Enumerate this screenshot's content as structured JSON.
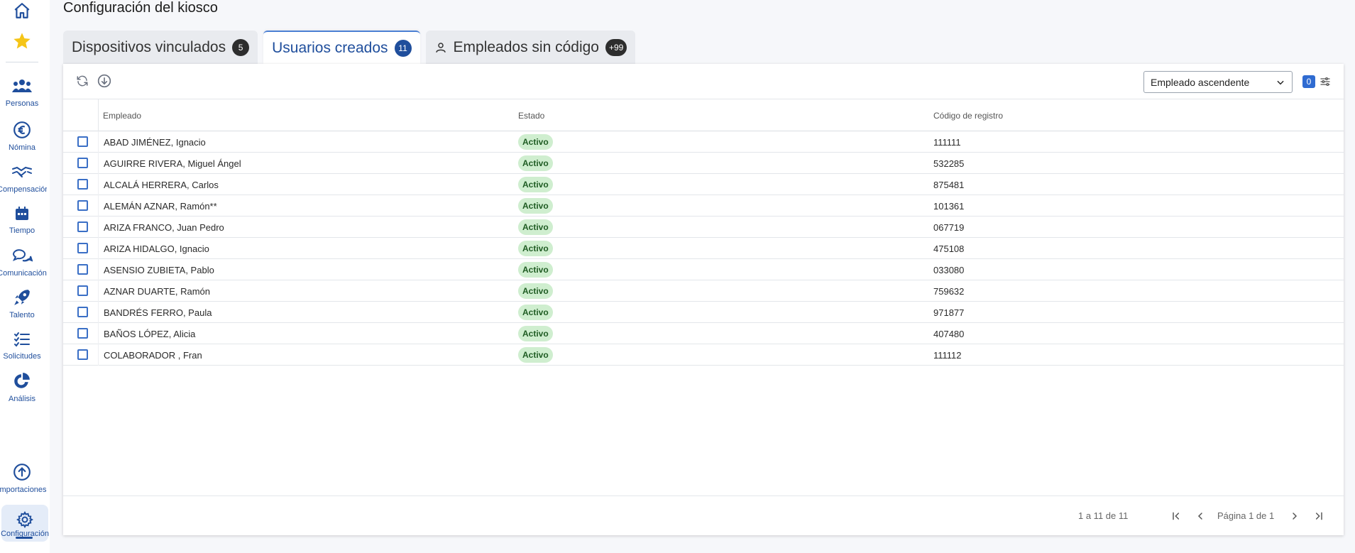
{
  "sidebar": {
    "items": [
      {
        "label": "Personas",
        "icon": "people-icon"
      },
      {
        "label": "Nómina",
        "icon": "euro-icon"
      },
      {
        "label": "Compensación",
        "icon": "handshake-icon"
      },
      {
        "label": "Tiempo",
        "icon": "calendar-icon"
      },
      {
        "label": "Comunicación",
        "icon": "chat-icon"
      },
      {
        "label": "Talento",
        "icon": "rocket-icon"
      },
      {
        "label": "Solicitudes",
        "icon": "checklist-icon"
      },
      {
        "label": "Análisis",
        "icon": "pie-chart-icon"
      },
      {
        "label": "Importaciones",
        "icon": "upload-icon"
      },
      {
        "label": "Configuración",
        "icon": "gear-icon"
      }
    ],
    "accent": "#1f4e9c"
  },
  "header": {
    "title": "Configuración del kiosco"
  },
  "tabs": [
    {
      "label": "Dispositivos vinculados",
      "count": "5"
    },
    {
      "label": "Usuarios creados",
      "count": "11"
    },
    {
      "label": "Empleados sin código",
      "count": "+99"
    }
  ],
  "toolbar": {
    "sort_value": "Empleado ascendente",
    "filter_count": "0"
  },
  "table": {
    "columns": [
      "Empleado",
      "Estado",
      "Código de registro"
    ],
    "rows": [
      {
        "name": "ABAD JIMÉNEZ, Ignacio",
        "status": "Activo",
        "code": "111111"
      },
      {
        "name": "AGUIRRE RIVERA, Miguel Ángel",
        "status": "Activo",
        "code": "532285"
      },
      {
        "name": "ALCALÁ HERRERA, Carlos",
        "status": "Activo",
        "code": "875481"
      },
      {
        "name": "ALEMÁN AZNAR, Ramón**",
        "status": "Activo",
        "code": "101361"
      },
      {
        "name": "ARIZA FRANCO, Juan Pedro",
        "status": "Activo",
        "code": "067719"
      },
      {
        "name": "ARIZA HIDALGO, Ignacio",
        "status": "Activo",
        "code": "475108"
      },
      {
        "name": "ASENSIO ZUBIETA, Pablo",
        "status": "Activo",
        "code": "033080"
      },
      {
        "name": "AZNAR DUARTE, Ramón",
        "status": "Activo",
        "code": "759632"
      },
      {
        "name": "BANDRÉS FERRO, Paula",
        "status": "Activo",
        "code": "971877"
      },
      {
        "name": "BAÑOS LÓPEZ, Alicia",
        "status": "Activo",
        "code": "407480"
      },
      {
        "name": "COLABORADOR , Fran",
        "status": "Activo",
        "code": "111112"
      }
    ]
  },
  "pagination": {
    "range": "1 a 11 de 11",
    "page": "Página 1 de 1"
  }
}
